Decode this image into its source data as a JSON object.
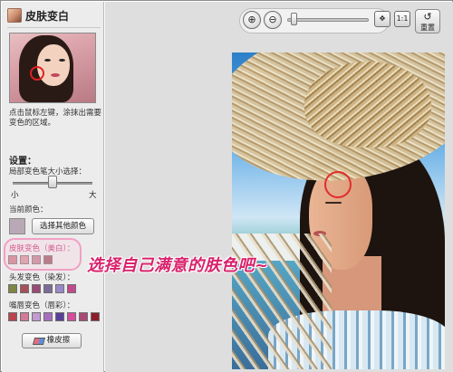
{
  "panel": {
    "title": "皮肤变白",
    "hint": "点击鼠标左键，涂抹出需要变色的区域。",
    "settings_label": "设置：",
    "brush_size_label": "局部变色笔大小选择：",
    "size_small": "小",
    "size_large": "大",
    "brush_size_level": 0.5,
    "current_color_label": "当前颜色：",
    "current_color": "#b9a9b6",
    "choose_color_button": "选择其他颜色",
    "groups": [
      {
        "label": "皮肤变色（美白）：",
        "colors": [
          "#c9707e",
          "#d58a93",
          "#c07888",
          "#9c4b5a"
        ]
      },
      {
        "label": "头发变色（染发）：",
        "colors": [
          "#7f8545",
          "#a6505a",
          "#9a4b73",
          "#7c6c98",
          "#9b88c8",
          "#c24a8c"
        ]
      },
      {
        "label": "嘴唇变色（唇彩）：",
        "colors": [
          "#b8454f",
          "#d27a9a",
          "#c39bd0",
          "#a86ec0",
          "#5a3f9a",
          "#d44d9e",
          "#a84a74",
          "#8c1f2c"
        ]
      }
    ],
    "eraser_button": "橡皮擦"
  },
  "toolbar": {
    "zoom_in_icon": "zoom-in-icon",
    "zoom_out_icon": "zoom-out-icon",
    "fit_icon": "fit-screen-icon",
    "actual_size_icon": "actual-size-icon",
    "actual_size_text": "1:1",
    "reset_label": "重置",
    "zoom_level": 0.05
  },
  "overlay": {
    "promo_text": "选择自己满意的肤色吧~"
  },
  "colors": {
    "accent": "#d9226c",
    "marker_circle": "#e22c2c",
    "panel_bg": "#ececec",
    "canvas_bg": "#dedede"
  }
}
